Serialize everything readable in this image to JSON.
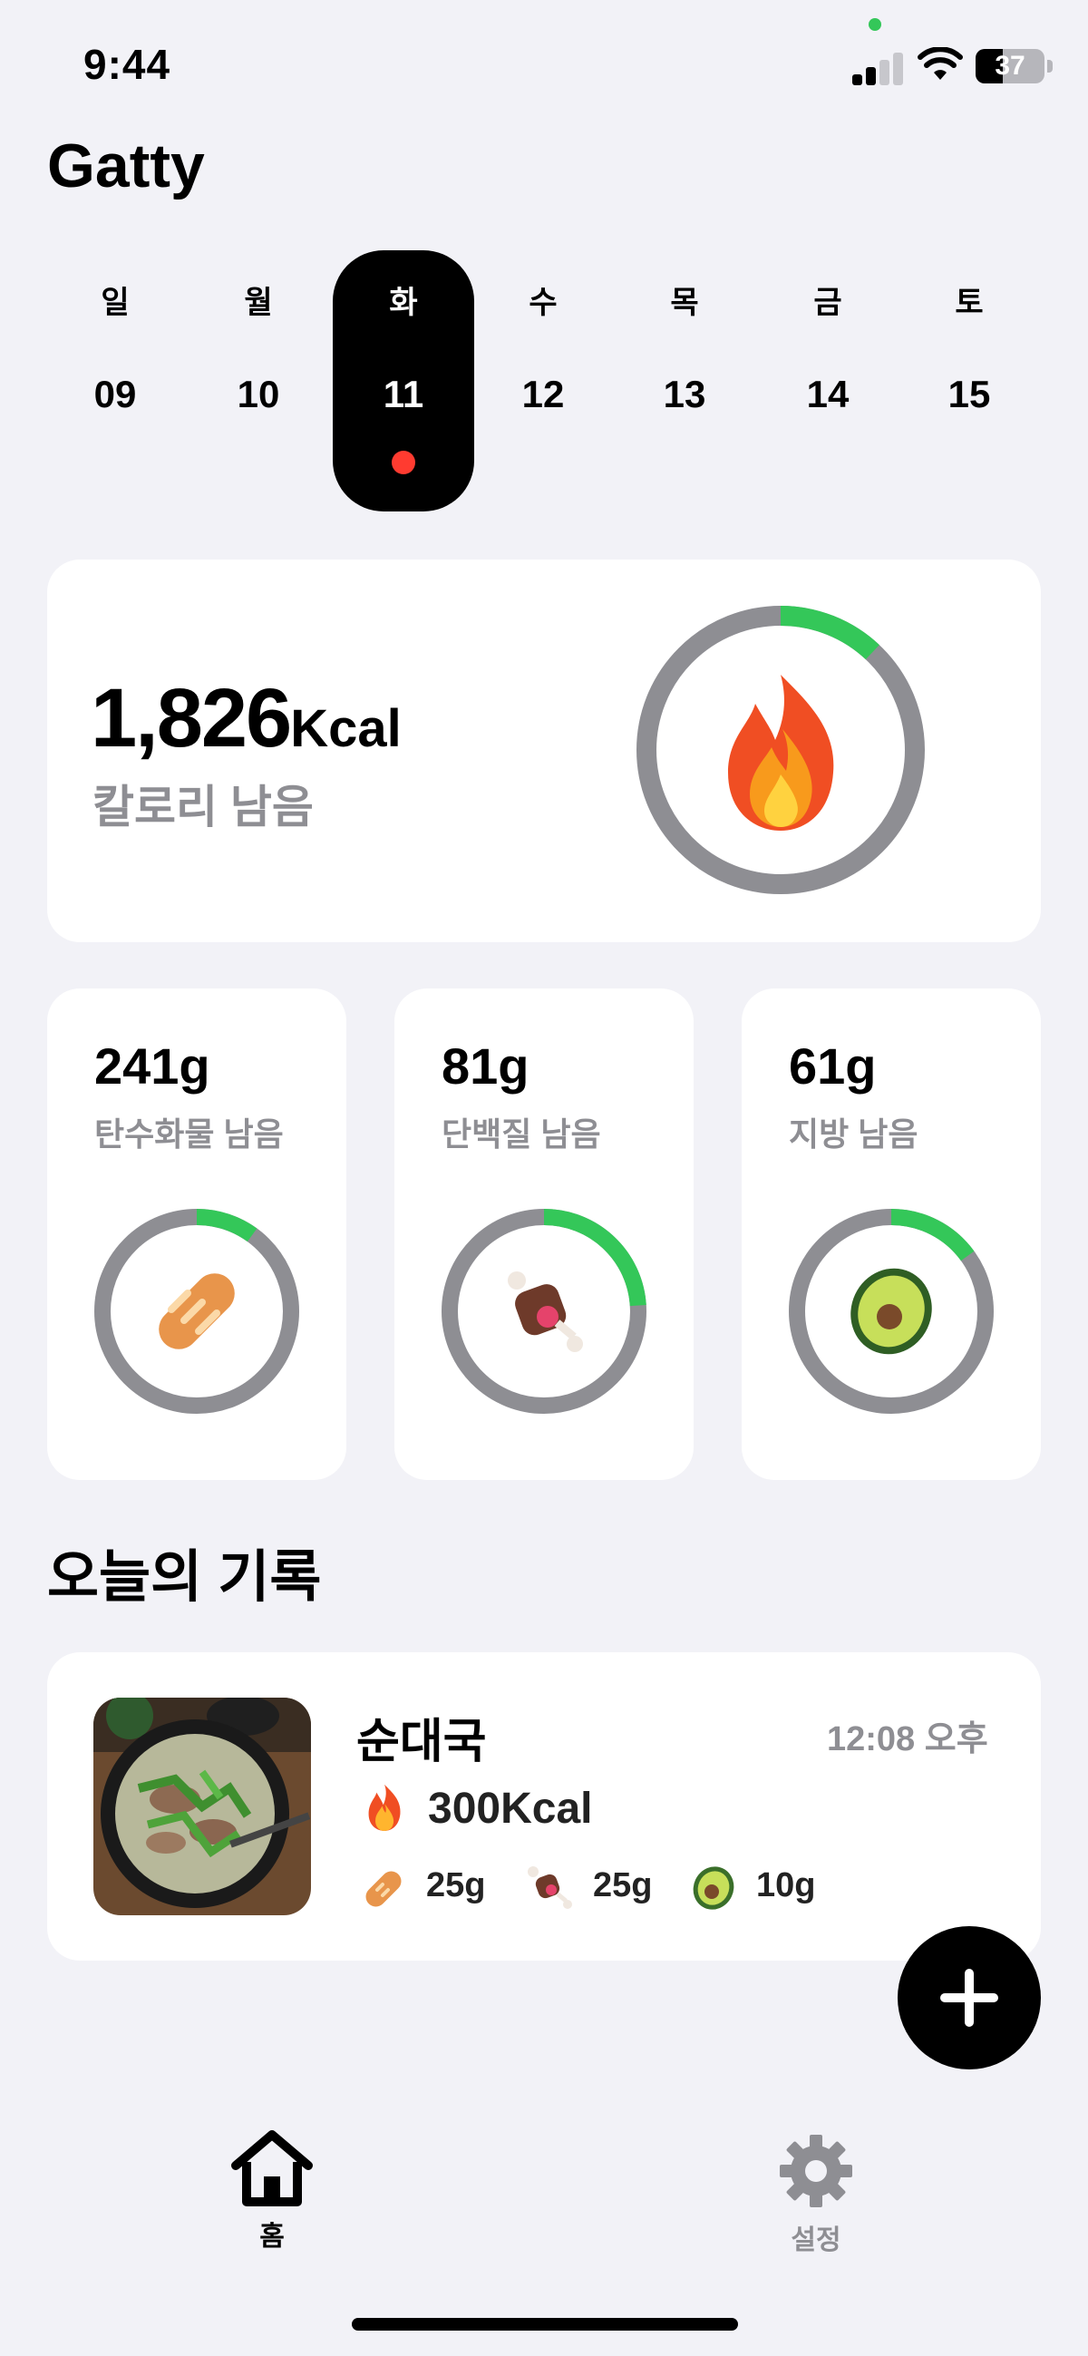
{
  "status": {
    "time": "9:44",
    "battery": "37"
  },
  "app": {
    "title": "Gatty"
  },
  "week": [
    {
      "day": "일",
      "date": "09"
    },
    {
      "day": "월",
      "date": "10"
    },
    {
      "day": "화",
      "date": "11"
    },
    {
      "day": "수",
      "date": "12"
    },
    {
      "day": "목",
      "date": "13"
    },
    {
      "day": "금",
      "date": "14"
    },
    {
      "day": "토",
      "date": "15"
    }
  ],
  "selected_day_index": 2,
  "calories": {
    "value": "1,826",
    "unit": "Kcal",
    "label": "칼로리 남음",
    "progress": 0.12,
    "icon": "fire-icon"
  },
  "macros": [
    {
      "value": "241g",
      "label": "탄수화물 남음",
      "progress": 0.1,
      "icon": "bread-icon"
    },
    {
      "value": "81g",
      "label": "단백질 남음",
      "progress": 0.24,
      "icon": "meat-icon"
    },
    {
      "value": "61g",
      "label": "지방 남음",
      "progress": 0.15,
      "icon": "avocado-icon"
    }
  ],
  "colors": {
    "ring_track": "#8e8e93",
    "ring_progress": "#34c759",
    "accent_dot": "#ff3b30"
  },
  "records": {
    "title": "오늘의 기록",
    "items": [
      {
        "name": "순대국",
        "time": "12:08 오후",
        "kcal": "300Kcal",
        "carbs": "25g",
        "protein": "25g",
        "fat": "10g"
      }
    ]
  },
  "tabbar": {
    "home": "홈",
    "settings": "설정"
  }
}
